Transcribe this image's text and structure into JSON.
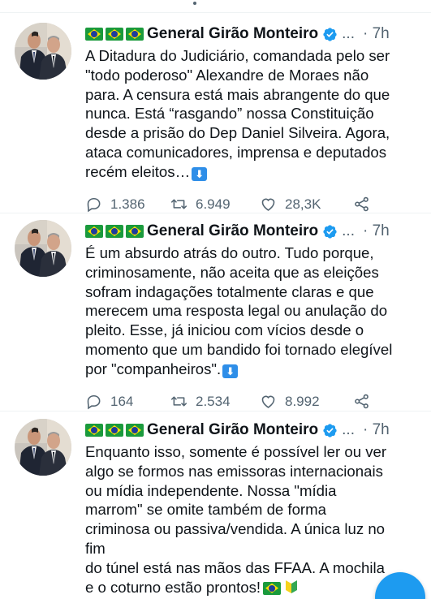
{
  "colors": {
    "accent": "#1d9bf0",
    "muted": "#536471",
    "text": "#0f1419",
    "divider": "#eff3f4"
  },
  "tweets": [
    {
      "author": "General Girão Monteiro",
      "more": "...",
      "time": "· 7h",
      "lines": [
        "A Ditadura do Judiciário, comandada pelo ser",
        "\"todo poderoso\" Alexandre de Moraes não",
        "para. A censura está mais abrangente do que",
        "nunca. Está “rasgando” nossa Constituição",
        "desde a prisão do Dep Daniel Silveira. Agora,",
        "ataca comunicadores, imprensa e deputados",
        "recém eleitos…"
      ],
      "replies": "1.386",
      "retweets": "6.949",
      "likes": "28,3K"
    },
    {
      "author": "General Girão Monteiro",
      "more": "...",
      "time": "· 7h",
      "lines": [
        "É um absurdo atrás do outro. Tudo porque,",
        "criminosamente, não aceita que as eleições",
        "sofram indagações totalmente claras e que",
        "merecem uma resposta legal ou anulação do",
        "pleito. Esse, já iniciou com vícios desde o",
        "momento que um bandido foi tornado elegível",
        "por \"companheiros\"."
      ],
      "replies": "164",
      "retweets": "2.534",
      "likes": "8.992"
    },
    {
      "author": "General Girão Monteiro",
      "more": "...",
      "time": "· 7h",
      "lines": [
        "Enquanto isso, somente é possível ler ou ver",
        "algo se formos nas emissoras internacionais",
        "ou mídia independente. Nossa \"mídia",
        "marrom\" se omite também de forma",
        "criminosa ou passiva/vendida. A única luz no",
        "fim",
        "do túnel está nas mãos das FFAA. A mochila",
        "e o coturno estão prontos!"
      ]
    }
  ],
  "icons": {
    "reply": "reply-icon",
    "retweet": "retweet-icon",
    "like": "heart-icon",
    "share": "share-icon",
    "verified": "verified-badge-icon",
    "down_arrow": "down-arrow-emoji-icon",
    "flag": "brazil-flag-emoji-icon",
    "beginner": "japanese-beginner-symbol-emoji-icon",
    "compose": "compose-fab-icon"
  }
}
